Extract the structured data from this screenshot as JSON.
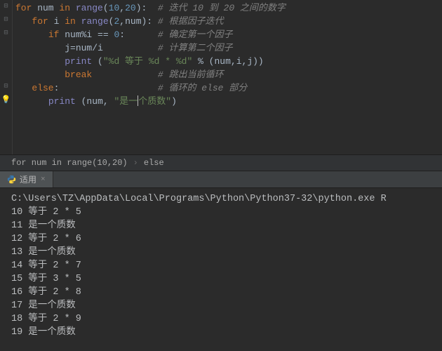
{
  "code": {
    "lines": [
      {
        "indent": 0,
        "tokens": [
          [
            "kw",
            "for"
          ],
          [
            "plain",
            " num "
          ],
          [
            "kw",
            "in"
          ],
          [
            "plain",
            " "
          ],
          [
            "fn",
            "range"
          ],
          [
            "plain",
            "("
          ],
          [
            "num",
            "10"
          ],
          [
            "op",
            ","
          ],
          [
            "num",
            "20"
          ],
          [
            "plain",
            "):  "
          ]
        ],
        "comment": "# 迭代 10 到 20 之间的数字"
      },
      {
        "indent": 1,
        "tokens": [
          [
            "kw",
            "for"
          ],
          [
            "plain",
            " i "
          ],
          [
            "kw",
            "in"
          ],
          [
            "plain",
            " "
          ],
          [
            "fn",
            "range"
          ],
          [
            "plain",
            "("
          ],
          [
            "num",
            "2"
          ],
          [
            "op",
            ","
          ],
          [
            "plain",
            "num): "
          ]
        ],
        "comment": "# 根据因子迭代"
      },
      {
        "indent": 2,
        "tokens": [
          [
            "kw",
            "if"
          ],
          [
            "plain",
            " num%i == "
          ],
          [
            "num",
            "0"
          ],
          [
            "plain",
            ":      "
          ]
        ],
        "comment": "# 确定第一个因子"
      },
      {
        "indent": 3,
        "tokens": [
          [
            "plain",
            "j=num/i          "
          ]
        ],
        "comment": "# 计算第二个因子"
      },
      {
        "indent": 3,
        "tokens": [
          [
            "fn",
            "print"
          ],
          [
            "plain",
            " ("
          ],
          [
            "str",
            "\"%d 等于 %d * %d\""
          ],
          [
            "plain",
            " % (num"
          ],
          [
            "op",
            ","
          ],
          [
            "plain",
            "i"
          ],
          [
            "op",
            ","
          ],
          [
            "plain",
            "j))"
          ]
        ],
        "comment": ""
      },
      {
        "indent": 3,
        "tokens": [
          [
            "kw",
            "break"
          ],
          [
            "plain",
            "            "
          ]
        ],
        "comment": "# 跳出当前循环"
      },
      {
        "indent": 1,
        "tokens": [
          [
            "kw",
            "else"
          ],
          [
            "plain",
            ":                  "
          ]
        ],
        "comment": "# 循环的 else 部分"
      },
      {
        "indent": 2,
        "tokens": [
          [
            "fn",
            "print"
          ],
          [
            "plain",
            " (num"
          ],
          [
            "op",
            ","
          ],
          [
            "plain",
            " "
          ],
          [
            "str",
            "\"是一"
          ],
          [
            "caret",
            ""
          ],
          [
            "str",
            "个质数\""
          ],
          [
            "plain",
            ")"
          ]
        ],
        "comment": ""
      }
    ],
    "folds": [
      0,
      1,
      2,
      6
    ],
    "bulb_line": 7
  },
  "breadcrumb": {
    "items": [
      "for num in range(10,20)",
      "else"
    ],
    "sep": "›"
  },
  "tab": {
    "label": "适用",
    "close": "×"
  },
  "console": {
    "lines": [
      "C:\\Users\\TZ\\AppData\\Local\\Programs\\Python\\Python37-32\\python.exe R",
      "10 等于 2 * 5",
      "11 是一个质数",
      "12 等于 2 * 6",
      "13 是一个质数",
      "14 等于 2 * 7",
      "15 等于 3 * 5",
      "16 等于 2 * 8",
      "17 是一个质数",
      "18 等于 2 * 9",
      "19 是一个质数"
    ]
  }
}
